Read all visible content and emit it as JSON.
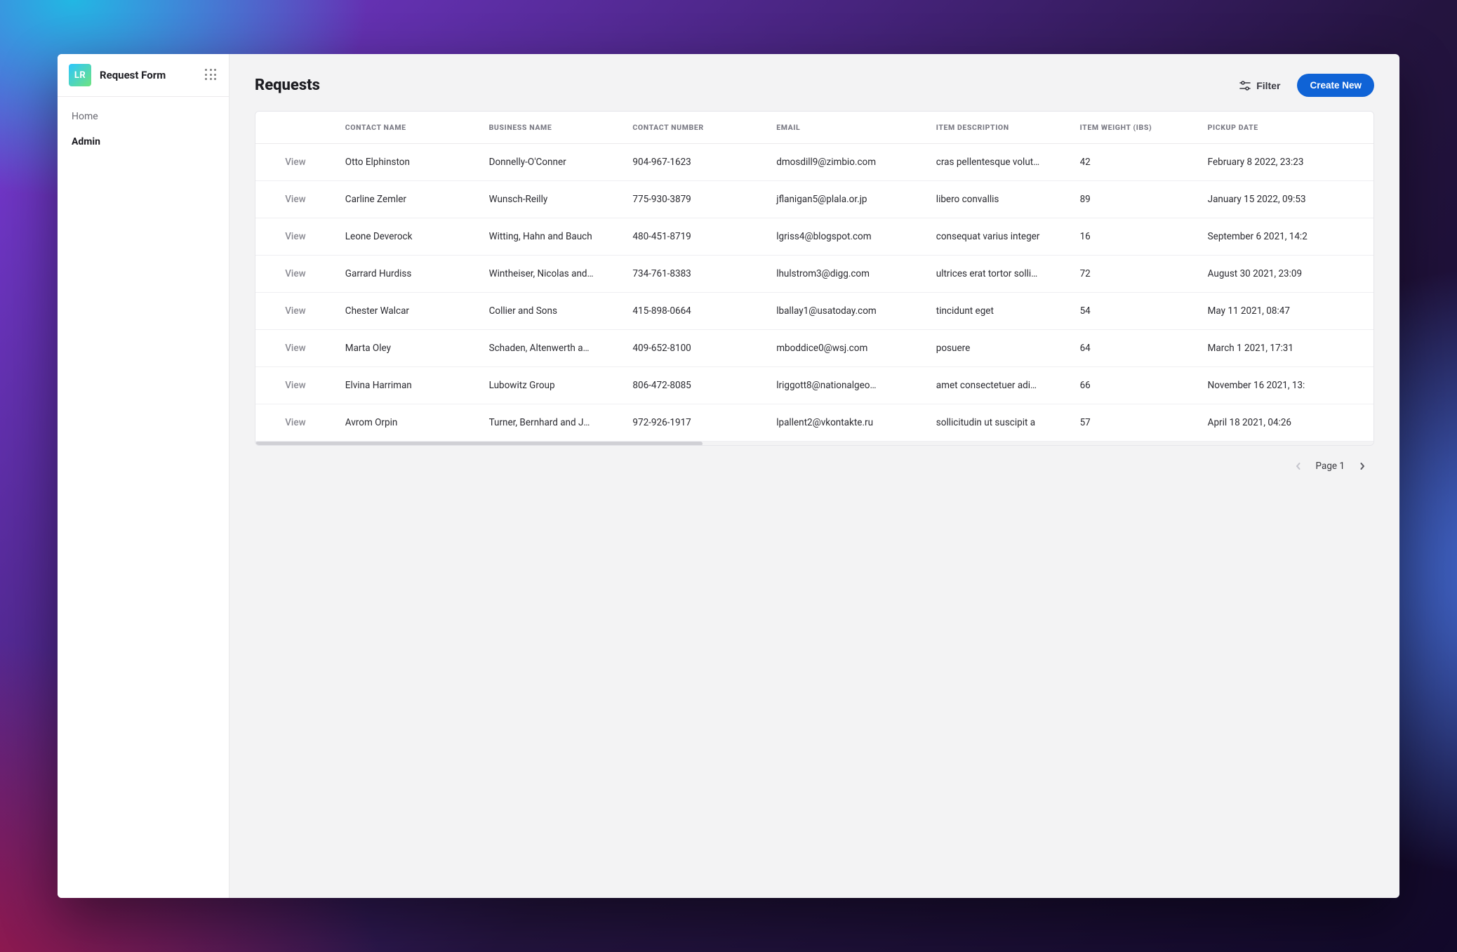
{
  "app": {
    "logo_initials": "LR",
    "title": "Request Form"
  },
  "sidebar": {
    "items": [
      {
        "label": "Home",
        "active": false
      },
      {
        "label": "Admin",
        "active": true
      }
    ]
  },
  "header": {
    "page_title": "Requests",
    "filter_label": "Filter",
    "create_label": "Create New"
  },
  "table": {
    "columns": [
      "",
      "CONTACT NAME",
      "BUSINESS NAME",
      "CONTACT NUMBER",
      "EMAIL",
      "ITEM DESCRIPTION",
      "ITEM WEIGHT (IBS)",
      "PICKUP DATE"
    ],
    "action_label": "View",
    "rows": [
      {
        "contact_name": "Otto Elphinston",
        "business_name": "Donnelly-O'Conner",
        "contact_number": "904-967-1623",
        "email": "dmosdill9@zimbio.com",
        "item_description": "cras pellentesque volut…",
        "item_weight": "42",
        "pickup_date": "February 8 2022, 23:23"
      },
      {
        "contact_name": "Carline Zemler",
        "business_name": "Wunsch-Reilly",
        "contact_number": "775-930-3879",
        "email": "jflanigan5@plala.or.jp",
        "item_description": "libero convallis",
        "item_weight": "89",
        "pickup_date": "January 15 2022, 09:53"
      },
      {
        "contact_name": "Leone Deverock",
        "business_name": "Witting, Hahn and Bauch",
        "contact_number": "480-451-8719",
        "email": "lgriss4@blogspot.com",
        "item_description": "consequat varius integer",
        "item_weight": "16",
        "pickup_date": "September 6 2021, 14:2"
      },
      {
        "contact_name": "Garrard Hurdiss",
        "business_name": "Wintheiser, Nicolas and…",
        "contact_number": "734-761-8383",
        "email": "lhulstrom3@digg.com",
        "item_description": "ultrices erat tortor solli…",
        "item_weight": "72",
        "pickup_date": "August 30 2021, 23:09"
      },
      {
        "contact_name": "Chester Walcar",
        "business_name": "Collier and Sons",
        "contact_number": "415-898-0664",
        "email": "lballay1@usatoday.com",
        "item_description": "tincidunt eget",
        "item_weight": "54",
        "pickup_date": "May 11 2021, 08:47"
      },
      {
        "contact_name": "Marta Oley",
        "business_name": "Schaden, Altenwerth a…",
        "contact_number": "409-652-8100",
        "email": "mboddice0@wsj.com",
        "item_description": "posuere",
        "item_weight": "64",
        "pickup_date": "March 1 2021, 17:31"
      },
      {
        "contact_name": "Elvina Harriman",
        "business_name": "Lubowitz Group",
        "contact_number": "806-472-8085",
        "email": "lriggott8@nationalgeo…",
        "item_description": "amet consectetuer adi…",
        "item_weight": "66",
        "pickup_date": "November 16 2021, 13:"
      },
      {
        "contact_name": "Avrom Orpin",
        "business_name": "Turner, Bernhard and J…",
        "contact_number": "972-926-1917",
        "email": "lpallent2@vkontakte.ru",
        "item_description": "sollicitudin ut suscipit a",
        "item_weight": "57",
        "pickup_date": "April 18 2021, 04:26"
      }
    ]
  },
  "pagination": {
    "label": "Page 1"
  }
}
